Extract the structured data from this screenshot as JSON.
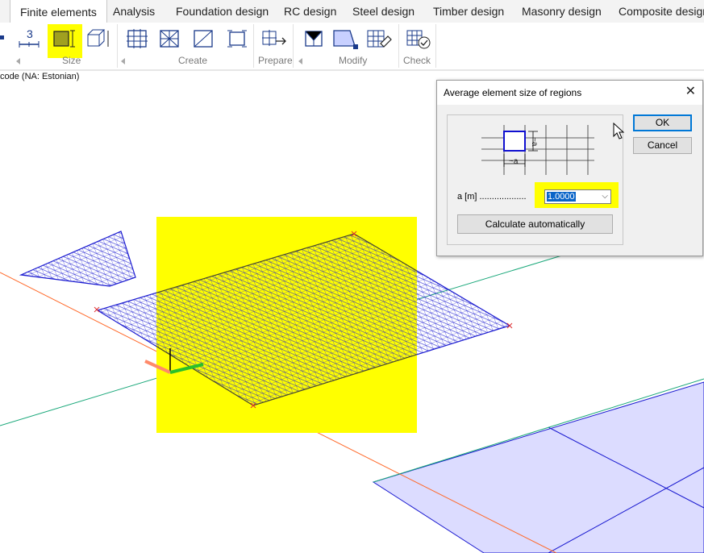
{
  "tabs": [
    {
      "label": "Finite elements",
      "active": true
    },
    {
      "label": "Analysis"
    },
    {
      "label": "Foundation design"
    },
    {
      "label": "RC design"
    },
    {
      "label": "Steel design"
    },
    {
      "label": "Timber design"
    },
    {
      "label": "Masonry design"
    },
    {
      "label": "Composite design"
    }
  ],
  "ribbon": {
    "size_number": "3",
    "groups": {
      "size": "Size",
      "create": "Create",
      "prepare": "Prepare",
      "modify": "Modify",
      "check": "Check"
    },
    "highlight_color": "#ffff00"
  },
  "status_text": "code (NA: Estonian)",
  "viewport": {
    "mesh_color": "#1a1ad0",
    "highlight_color": "#ffff00",
    "axis_x_color": "#ff6a2b",
    "axis_y_color": "#1aa87a",
    "slab_fill": "#dcdcff"
  },
  "dialog": {
    "title": "Average element size of regions",
    "figure_label": "~a",
    "size_label": "a [m] ...................",
    "size_value": "1.0000",
    "calc_button": "Calculate automatically",
    "ok": "OK",
    "cancel": "Cancel"
  }
}
